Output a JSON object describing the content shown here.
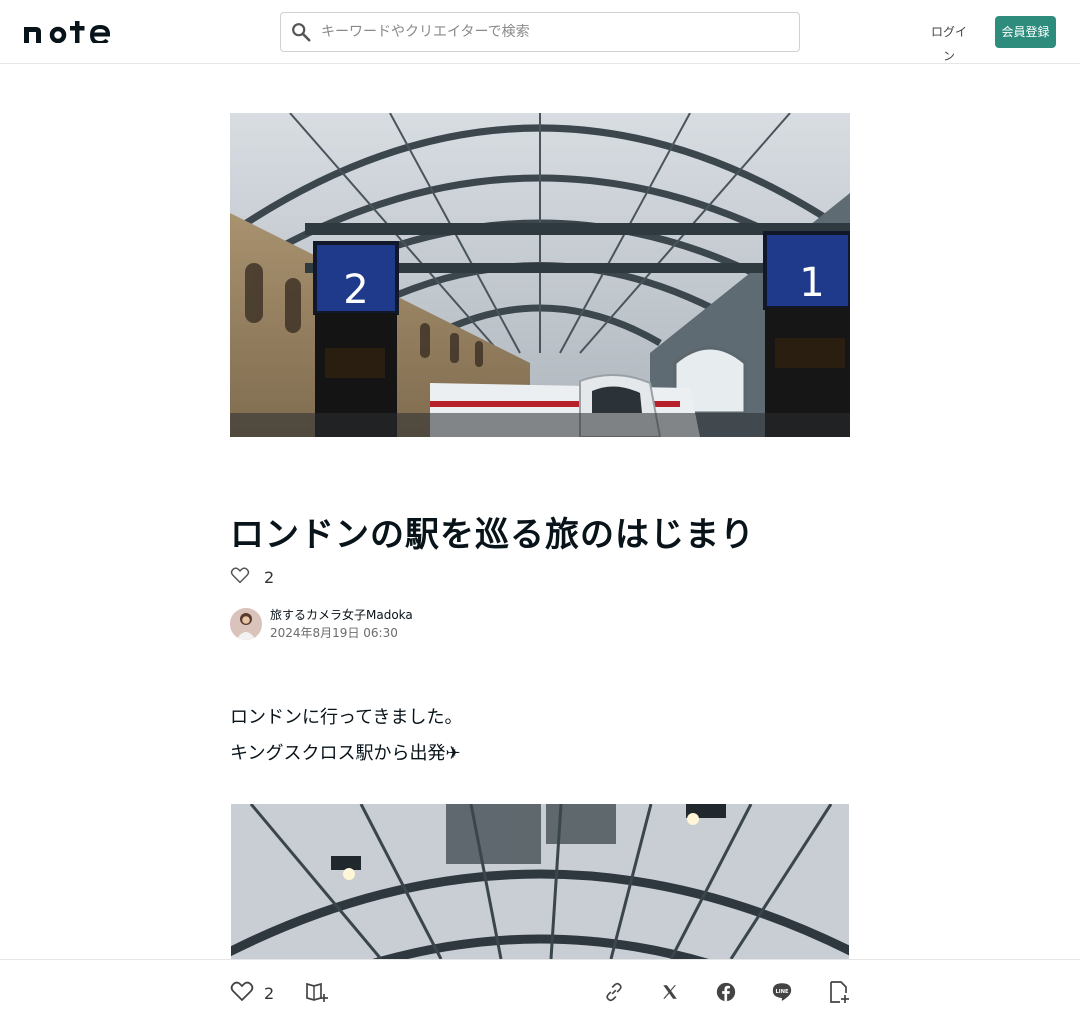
{
  "header": {
    "logo": "note",
    "search_placeholder": "キーワードやクリエイターで検索",
    "login_label": "ログイン",
    "signup_label": "会員登録"
  },
  "article": {
    "title": "ロンドンの駅を巡る旅のはじまり",
    "like_count": "2",
    "author_name": "旅するカメラ女子Madoka",
    "date": "2024年8月19日 06:30",
    "body_lines": [
      "ロンドンに行ってきました。",
      "キングスクロス駅から出発✈"
    ],
    "hero_sign_left": "2",
    "hero_sign_right": "1"
  },
  "footer": {
    "like_count": "2"
  },
  "colors": {
    "accent": "#2d8c7c",
    "text": "#08131a"
  },
  "icons": {
    "search": "search-icon",
    "heart": "heart-icon",
    "magazine_add": "magazine-add-icon",
    "link": "link-icon",
    "x": "x-logo-icon",
    "facebook": "facebook-icon",
    "line": "line-icon",
    "note_add": "note-add-icon"
  }
}
